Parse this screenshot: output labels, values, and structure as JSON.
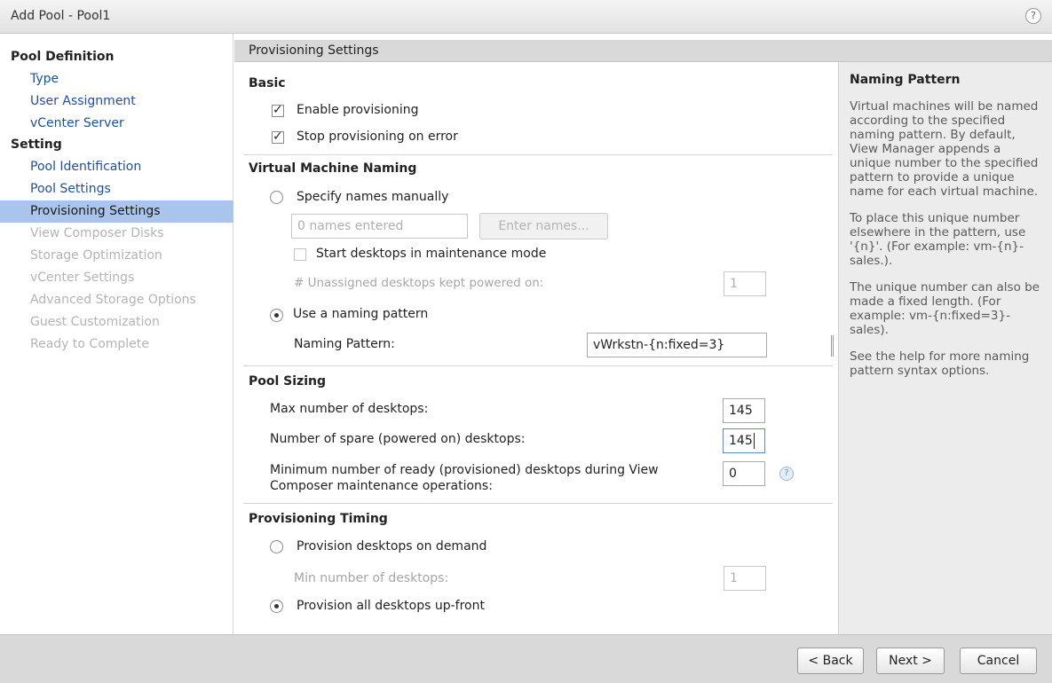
{
  "window": {
    "title": "Add Pool - Pool1",
    "help_icon": "?"
  },
  "sidebar": {
    "groups": [
      {
        "heading": "Pool Definition",
        "items": [
          {
            "label": "Type",
            "state": "link"
          },
          {
            "label": "User Assignment",
            "state": "link"
          },
          {
            "label": "vCenter Server",
            "state": "link"
          }
        ]
      },
      {
        "heading": "Setting",
        "items": [
          {
            "label": "Pool Identification",
            "state": "link"
          },
          {
            "label": "Pool Settings",
            "state": "link"
          },
          {
            "label": "Provisioning Settings",
            "state": "active"
          },
          {
            "label": "View Composer Disks",
            "state": "disabled"
          },
          {
            "label": "Storage Optimization",
            "state": "disabled"
          },
          {
            "label": "vCenter Settings",
            "state": "disabled"
          },
          {
            "label": "Advanced Storage Options",
            "state": "disabled"
          },
          {
            "label": "Guest Customization",
            "state": "disabled"
          },
          {
            "label": "Ready to Complete",
            "state": "disabled"
          }
        ]
      }
    ]
  },
  "section_title": "Provisioning Settings",
  "basic": {
    "title": "Basic",
    "enable_provisioning": {
      "label": "Enable provisioning",
      "checked": true
    },
    "stop_on_error": {
      "label": "Stop provisioning on error",
      "checked": true
    }
  },
  "vm_naming": {
    "title": "Virtual Machine Naming",
    "manual": {
      "label": "Specify names manually",
      "selected": false
    },
    "names_entered_placeholder": "0 names entered",
    "enter_names_button": "Enter names...",
    "maintenance_mode": {
      "label": "Start desktops in maintenance mode",
      "checked": false
    },
    "unassigned_powered_on": {
      "label": "# Unassigned desktops kept powered on:",
      "value": "1"
    },
    "pattern": {
      "label": "Use a naming pattern",
      "selected": true
    },
    "naming_pattern_label": "Naming Pattern:",
    "naming_pattern_value": "vWrkstn-{n:fixed=3}"
  },
  "pool_sizing": {
    "title": "Pool Sizing",
    "max_desktops": {
      "label": "Max number of desktops:",
      "value": "145"
    },
    "spare_desktops": {
      "label": "Number of spare (powered on) desktops:",
      "value": "145"
    },
    "min_ready": {
      "label_line1": "Minimum number of ready (provisioned) desktops during View",
      "label_line2": "Composer maintenance operations:",
      "value": "0"
    }
  },
  "provisioning_timing": {
    "title": "Provisioning Timing",
    "on_demand": {
      "label": "Provision desktops on demand",
      "selected": false
    },
    "min_desktops": {
      "label": "Min number of desktops:",
      "value": "1"
    },
    "up_front": {
      "label": "Provision all desktops up-front",
      "selected": true
    }
  },
  "help_panel": {
    "title": "Naming Pattern",
    "paragraphs": [
      "Virtual machines will be named according to the specified naming pattern. By default, View Manager appends a unique number to the specified pattern to provide a unique name for each virtual machine.",
      "To place this unique number elsewhere in the pattern, use '{n}'. (For example: vm-{n}-sales.).",
      "The unique number can also be made a fixed length. (For example: vm-{n:fixed=3}-sales).",
      "See the help for more naming pattern syntax options."
    ]
  },
  "footer": {
    "back": "< Back",
    "next": "Next >",
    "cancel": "Cancel"
  }
}
